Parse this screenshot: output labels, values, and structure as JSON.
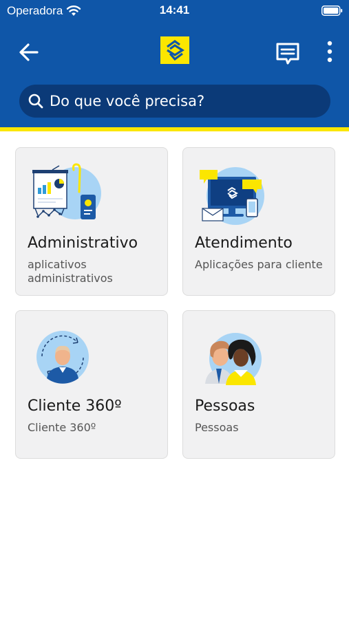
{
  "status_bar": {
    "carrier": "Operadora",
    "time": "14:41"
  },
  "header": {
    "brand_colors": {
      "blue": "#0f56a8",
      "yellow": "#fbe600",
      "search_bg": "#0b3a78"
    },
    "icons": {
      "back": "arrow-left-icon",
      "logo": "bb-logo-icon",
      "chat": "chat-icon",
      "more": "more-vertical-icon"
    }
  },
  "search": {
    "placeholder": "Do que você precisa?"
  },
  "cards": [
    {
      "title": "Administrativo",
      "subtitle": "aplicativos administrativos",
      "icon": "presentation-board-illustration"
    },
    {
      "title": "Atendimento",
      "subtitle": "Aplicações para cliente",
      "icon": "monitor-chat-illustration"
    },
    {
      "title": "Cliente 360º",
      "subtitle": "Cliente 360º",
      "icon": "customer-cycle-illustration"
    },
    {
      "title": "Pessoas",
      "subtitle": "Pessoas",
      "icon": "people-illustration"
    }
  ]
}
